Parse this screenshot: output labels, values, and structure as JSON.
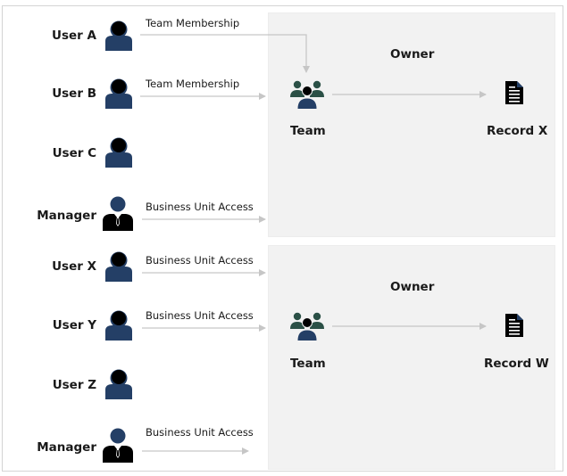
{
  "colors": {
    "user_body": "#243f66",
    "user_head": "#000000",
    "team_side": "#2b5046",
    "panel_bg": "#f2f2f2",
    "arrow": "#c6c6c6"
  },
  "groups": [
    {
      "users": [
        {
          "label": "User A",
          "icon": "user-icon",
          "edge": "Team Membership"
        },
        {
          "label": "User B",
          "icon": "user-icon",
          "edge": "Team Membership"
        },
        {
          "label": "User C",
          "icon": "user-icon",
          "edge": ""
        },
        {
          "label": "Manager",
          "icon": "manager-icon",
          "edge": "Business Unit Access"
        }
      ],
      "owner_label": "Owner",
      "team_label": "Team",
      "record_label": "Record X"
    },
    {
      "users": [
        {
          "label": "User X",
          "icon": "user-icon",
          "edge": "Business Unit Access"
        },
        {
          "label": "User Y",
          "icon": "user-icon",
          "edge": "Business Unit Access"
        },
        {
          "label": "User Z",
          "icon": "user-icon",
          "edge": ""
        },
        {
          "label": "Manager",
          "icon": "manager-icon",
          "edge": "Business Unit Access"
        }
      ],
      "owner_label": "Owner",
      "team_label": "Team",
      "record_label": "Record W"
    }
  ]
}
